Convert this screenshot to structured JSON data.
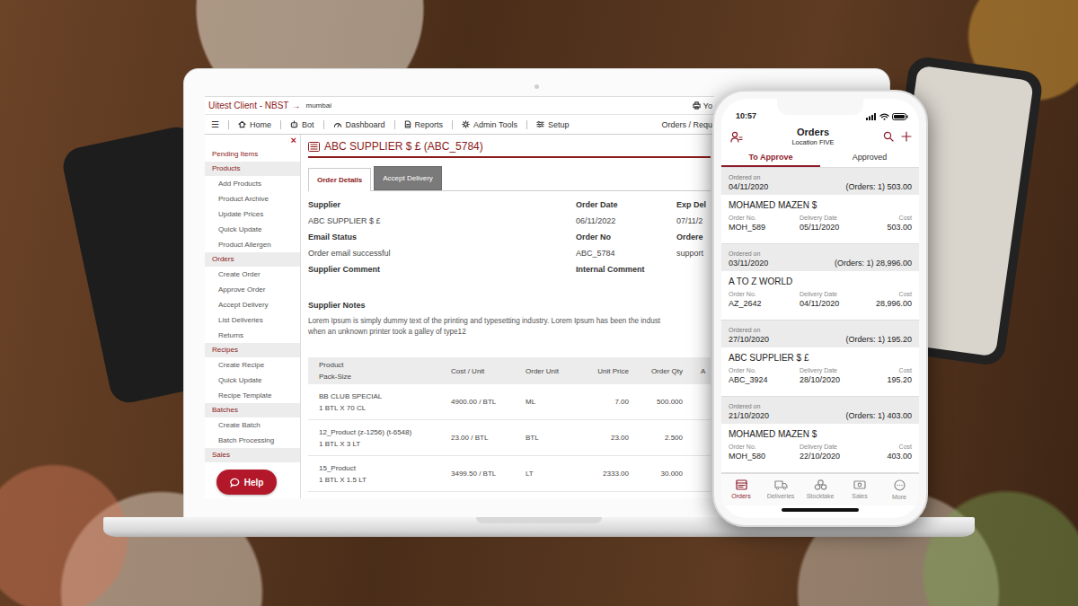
{
  "laptop": {
    "header": {
      "client": "Uitest Client - NBST",
      "arrow": "→",
      "location": "mumbai",
      "user": "Yo"
    },
    "nav": {
      "menu": "☰",
      "items": [
        {
          "label": "Home"
        },
        {
          "label": "Bot"
        },
        {
          "label": "Dashboard"
        },
        {
          "label": "Reports"
        },
        {
          "label": "Admin Tools"
        },
        {
          "label": "Setup"
        }
      ],
      "right": "Orders / Requ"
    },
    "sidebar": {
      "close": "×",
      "top": "Pending Items",
      "sections": [
        {
          "title": "Products",
          "items": [
            "Add Products",
            "Product Archive",
            "Update Prices",
            "Quick Update",
            "Product Allergen"
          ]
        },
        {
          "title": "Orders",
          "items": [
            "Create Order",
            "Approve Order",
            "Accept Delivery",
            "List Deliveries",
            "Returns"
          ]
        },
        {
          "title": "Recipes",
          "items": [
            "Create Recipe",
            "Quick Update",
            "Recipe Template"
          ]
        },
        {
          "title": "Batches",
          "items": [
            "Create Batch",
            "Batch Processing"
          ]
        },
        {
          "title": "Sales",
          "items": []
        }
      ]
    },
    "help": "Help",
    "page": {
      "title": "ABC SUPPLIER $ £ (ABC_5784)",
      "tabs": [
        {
          "label": "Order Details",
          "selected": true
        },
        {
          "label": "Accept Delivery",
          "selected": false
        }
      ],
      "fields": [
        [
          {
            "label": "Supplier",
            "value": "ABC SUPPLIER $ £"
          },
          {
            "label": "Order Date",
            "value": "06/11/2022"
          },
          {
            "label": "Exp Del",
            "value": "07/11/2"
          }
        ],
        [
          {
            "label": "Email Status",
            "value": "Order email successful"
          },
          {
            "label": "Order No",
            "value": "ABC_5784"
          },
          {
            "label": "Ordere",
            "value": "support"
          }
        ],
        [
          {
            "label": "Supplier Comment"
          },
          {
            "label": "Internal Comment"
          }
        ]
      ],
      "notes": {
        "label": "Supplier Notes",
        "lines": [
          "Lorem Ipsum is simply dummy text of the printing and typesetting industry. Lorem Ipsum has been the indust",
          "when an unknown printer took a galley of type12"
        ]
      },
      "table": {
        "columns": [
          {
            "label": "Product",
            "sub": "Pack-Size"
          },
          {
            "label": "Cost / Unit"
          },
          {
            "label": "Order Unit"
          },
          {
            "label": "Unit Price"
          },
          {
            "label": "Order Qty"
          },
          {
            "label": "A"
          }
        ],
        "rows": [
          {
            "product": "BB CLUB SPECIAL",
            "pack": "1 BTL X 70 CL",
            "cells": [
              "4900.00 / BTL",
              "ML",
              "7.00",
              "500.000"
            ]
          },
          {
            "product": "12_Product (z-1256) (t-6548)",
            "pack": "1 BTL X 3 LT",
            "cells": [
              "23.00 / BTL",
              "BTL",
              "23.00",
              "2.500"
            ]
          },
          {
            "product": "15_Product",
            "pack": "1 BTL X 1.5 LT",
            "cells": [
              "3499.50 / BTL",
              "LT",
              "2333.00",
              "30.000"
            ]
          }
        ]
      }
    }
  },
  "phone": {
    "status_bar": {
      "time": "10:57"
    },
    "title": "Orders",
    "subtitle": "Location FIVE",
    "tabs": [
      {
        "label": "To Approve",
        "selected": true
      },
      {
        "label": "Approved",
        "selected": false
      }
    ],
    "groups": [
      {
        "ordered_label": "Ordered on",
        "date": "04/11/2020",
        "summary": "(Orders: 1) 503.00",
        "order": {
          "name": "MOHAMED MAZEN $",
          "fields": [
            {
              "label": "Order No.",
              "value": "MOH_589"
            },
            {
              "label": "Delivery Date",
              "value": "05/11/2020"
            },
            {
              "label": "Cost",
              "value": "503.00"
            }
          ]
        }
      },
      {
        "ordered_label": "Ordered on",
        "date": "03/11/2020",
        "summary": "(Orders: 1) 28,996.00",
        "order": {
          "name": "A TO Z WORLD",
          "fields": [
            {
              "label": "Order No.",
              "value": "AZ_2642"
            },
            {
              "label": "Delivery Date",
              "value": "04/11/2020"
            },
            {
              "label": "Cost",
              "value": "28,996.00"
            }
          ]
        }
      },
      {
        "ordered_label": "Ordered on",
        "date": "27/10/2020",
        "summary": "(Orders: 1) 195.20",
        "order": {
          "name": "ABC SUPPLIER $ £",
          "fields": [
            {
              "label": "Order No.",
              "value": "ABC_3924"
            },
            {
              "label": "Delivery Date",
              "value": "28/10/2020"
            },
            {
              "label": "Cost",
              "value": "195.20"
            }
          ]
        }
      },
      {
        "ordered_label": "Ordered on",
        "date": "21/10/2020",
        "summary": "(Orders: 1) 403.00",
        "order": {
          "name": "MOHAMED MAZEN $",
          "fields": [
            {
              "label": "Order No.",
              "value": "MOH_580"
            },
            {
              "label": "Delivery Date",
              "value": "22/10/2020"
            },
            {
              "label": "Cost",
              "value": "403.00"
            }
          ]
        }
      }
    ],
    "bottom_tabs": [
      {
        "label": "Orders",
        "selected": true
      },
      {
        "label": "Deliveries",
        "selected": false
      },
      {
        "label": "Stocktake",
        "selected": false
      },
      {
        "label": "Sales",
        "selected": false
      },
      {
        "label": "More",
        "selected": false
      }
    ]
  }
}
